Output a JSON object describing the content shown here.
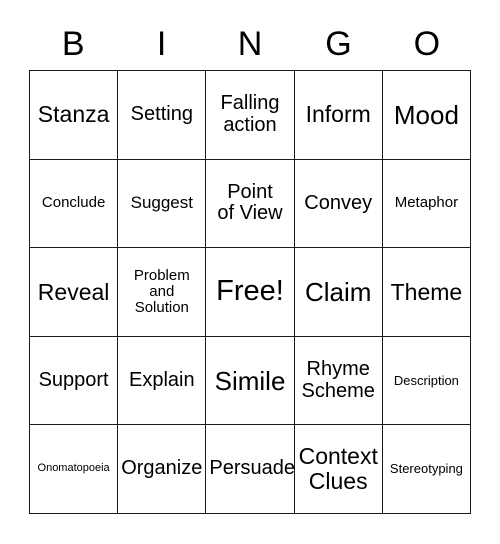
{
  "card": {
    "title_letters": [
      "B",
      "I",
      "N",
      "G",
      "O"
    ],
    "colors": {
      "background": "#ffffff",
      "grid_line": "#1a1a1a",
      "text": "#000000"
    },
    "rows": [
      [
        {
          "text": "Stanza",
          "size": "lg"
        },
        {
          "text": "Setting",
          "size": "md"
        },
        {
          "text": "Falling\naction",
          "size": "md"
        },
        {
          "text": "Inform",
          "size": "lg"
        },
        {
          "text": "Mood",
          "size": "xl"
        }
      ],
      [
        {
          "text": "Conclude",
          "size": "xs"
        },
        {
          "text": "Suggest",
          "size": "sm"
        },
        {
          "text": "Point\nof View",
          "size": "md"
        },
        {
          "text": "Convey",
          "size": "md"
        },
        {
          "text": "Metaphor",
          "size": "xs"
        }
      ],
      [
        {
          "text": "Reveal",
          "size": "lg"
        },
        {
          "text": "Problem\nand\nSolution",
          "size": "xs"
        },
        {
          "text": "Free!",
          "size": "xxl"
        },
        {
          "text": "Claim",
          "size": "xl"
        },
        {
          "text": "Theme",
          "size": "lg"
        }
      ],
      [
        {
          "text": "Support",
          "size": "md"
        },
        {
          "text": "Explain",
          "size": "md"
        },
        {
          "text": "Simile",
          "size": "xl"
        },
        {
          "text": "Rhyme\nScheme",
          "size": "md"
        },
        {
          "text": "Description",
          "size": "xxs"
        }
      ],
      [
        {
          "text": "Onomatopoeia",
          "size": "tiny"
        },
        {
          "text": "Organize",
          "size": "md"
        },
        {
          "text": "Persuade",
          "size": "md"
        },
        {
          "text": "Context\nClues",
          "size": "lg"
        },
        {
          "text": "Stereotyping",
          "size": "xxs"
        }
      ]
    ]
  }
}
